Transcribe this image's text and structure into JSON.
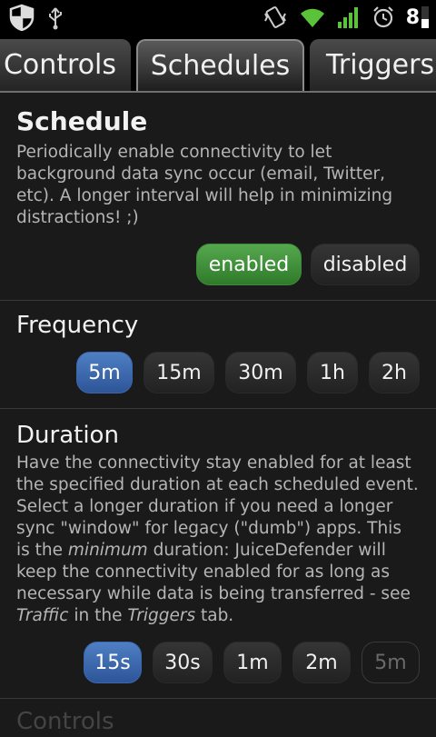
{
  "status_bar": {
    "icons_left": [
      "shield-icon",
      "usb-icon"
    ],
    "icons_right": [
      "vibrate-icon",
      "wifi-icon",
      "signal-icon",
      "alarm-icon"
    ],
    "battery_text": "8"
  },
  "tabs": [
    {
      "label": "Controls",
      "active": false
    },
    {
      "label": "Schedules",
      "active": true
    },
    {
      "label": "Triggers",
      "active": false
    }
  ],
  "schedule": {
    "title": "Schedule",
    "description": "Periodically enable connectivity to let background data sync occur (email, Twitter, etc). A longer interval will help in minimizing distractions! ;)",
    "options": [
      {
        "label": "enabled",
        "selected": true
      },
      {
        "label": "disabled",
        "selected": false
      }
    ]
  },
  "frequency": {
    "title": "Frequency",
    "options": [
      "5m",
      "15m",
      "30m",
      "1h",
      "2h"
    ],
    "selected": "5m"
  },
  "duration": {
    "title": "Duration",
    "desc_1": "Have the connectivity stay enabled for at least the specified duration at each scheduled event. Select a longer duration if you need a longer sync \"window\" for legacy (\"dumb\") apps. This is the ",
    "desc_em1": "minimum",
    "desc_2": " duration: JuiceDefender will keep the connectivity enabled for as long as necessary while data is being transferred - see ",
    "desc_em2": "Traffic",
    "desc_3": " in the ",
    "desc_em3": "Triggers",
    "desc_4": " tab.",
    "options": [
      "15s",
      "30s",
      "1m",
      "2m",
      "5m"
    ],
    "selected": "15s",
    "disabled_option": "5m"
  },
  "next_section_partial": "Controls"
}
